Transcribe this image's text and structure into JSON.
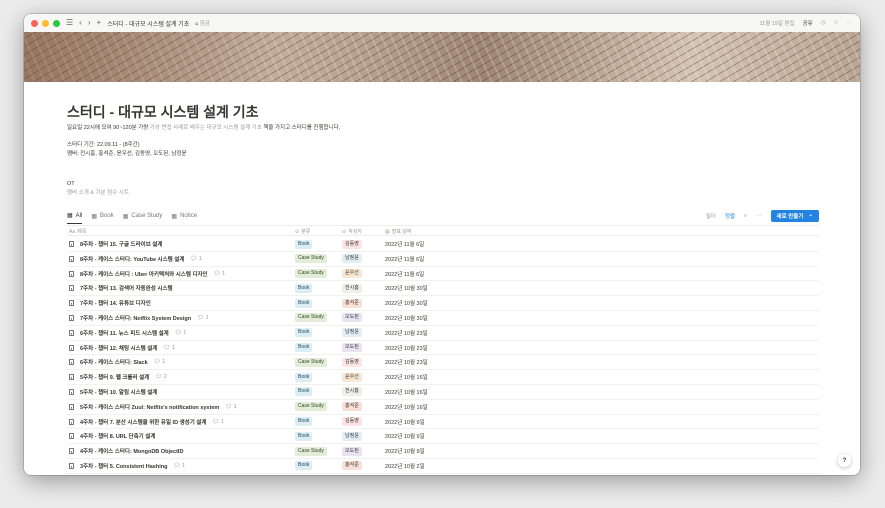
{
  "titlebar": {
    "title": "스터디 - 대규모 시스템 설계 기초",
    "lock_label": "잠금",
    "edited": "11월 19일 편집",
    "share": "공유"
  },
  "page": {
    "title": "스터디 - 대규모 시스템 설계 기초",
    "desc_main": "일요일 22시에 모여 90~120분 가량",
    "desc_muted": "가상 면접 사례로 배우는 대규모 시스템 설계 기초",
    "desc_end": "책을 가지고 스터디를 진행합니다.",
    "period": "스터디 기간: 22.09.11 - (8주간)",
    "members": "멤버: 전시흠, 홍석준, 윤우선, 김동영, 오도된, 남정윤",
    "ot": "OT",
    "ot_sub": "멤버 소개 & 기분 점수 시트"
  },
  "tabs": [
    {
      "label": "All",
      "icon": "grid-icon"
    },
    {
      "label": "Book",
      "icon": "grid-icon"
    },
    {
      "label": "Case Study",
      "icon": "grid-icon"
    },
    {
      "label": "Notice",
      "icon": "grid-icon"
    }
  ],
  "toolbar": {
    "filter": "필터",
    "sort": "정렬",
    "more": "···",
    "new_button": "새로 만들기",
    "new_chevron": "⌄"
  },
  "columns": {
    "name": "제목",
    "category": "분류",
    "author": "작성자",
    "date": "발표 날짜"
  },
  "colors": {
    "accent": "#2383e2",
    "book_tag": "#dbeef4",
    "case_tag": "#e2ecd9"
  },
  "rows": [
    {
      "name": "8주차 - 챕터 15. 구글 드라이브 설계",
      "comments": "",
      "category": "Book",
      "author": "김동영",
      "author_color": "#fbe4e4",
      "date": "2022년 11월 6일"
    },
    {
      "name": "8주차 - 케이스 스터디: YouTube 시스템 설계",
      "comments": "1",
      "category": "Case Study",
      "author": "남정윤",
      "author_color": "#e1eef5",
      "date": "2022년 11월 6일"
    },
    {
      "name": "8주차 - 케이스 스터디 : Uber 아키텍처와 시스템 디자인",
      "comments": "1",
      "category": "Case Study",
      "author": "윤우선",
      "author_color": "#f9e8d5",
      "date": "2022년 11월 6일"
    },
    {
      "name": "7주차 - 챕터 13. 검색어 자동완성 시스템",
      "comments": "",
      "category": "Book",
      "author": "전시흠",
      "author_color": "#eeeeec",
      "date": "2022년 10월 30일"
    },
    {
      "name": "7주차 - 챕터 14. 유튜브 디자인",
      "comments": "",
      "category": "Book",
      "author": "홍석준",
      "author_color": "#f9e0d6",
      "date": "2022년 10월 30일"
    },
    {
      "name": "7주차 - 케이스 스터디: Netflix System Design",
      "comments": "1",
      "category": "Case Study",
      "author": "오도된",
      "author_color": "#e8e3f3",
      "date": "2022년 10월 30일"
    },
    {
      "name": "6주차 - 챕터 11. 뉴스 피드 시스템 설계",
      "comments": "1",
      "category": "Book",
      "author": "남정윤",
      "author_color": "#e1eef5",
      "date": "2022년 10월 23일"
    },
    {
      "name": "6주차 - 챕터 12. 채팅 시스템 설계",
      "comments": "1",
      "category": "Book",
      "author": "오도된",
      "author_color": "#e8e3f3",
      "date": "2022년 10월 23일"
    },
    {
      "name": "6주차 - 케이스 스터디: Slack",
      "comments": "1",
      "category": "Case Study",
      "author": "김동영",
      "author_color": "#fbe4e4",
      "date": "2022년 10월 23일"
    },
    {
      "name": "5주차 - 챕터 9. 웹 크롤러 설계",
      "comments": "2",
      "category": "Book",
      "author": "윤우선",
      "author_color": "#f9e8d5",
      "date": "2022년 10월 16일"
    },
    {
      "name": "5주차 - 챕터 10. 알림 시스템 설계",
      "comments": "",
      "category": "Book",
      "author": "전시흠",
      "author_color": "#eeeeec",
      "date": "2022년 10월 16일"
    },
    {
      "name": "5주차 - 케이스 스터디 Zuul: Netflix's notification system",
      "comments": "1",
      "category": "Case Study",
      "author": "홍석준",
      "author_color": "#f9e0d6",
      "date": "2022년 10월 16일"
    },
    {
      "name": "4주차 - 챕터 7. 분산 시스템을 위한 유일 ID 생성기 설계",
      "comments": "1",
      "category": "Book",
      "author": "김동영",
      "author_color": "#fbe4e4",
      "date": "2022년 10월 9일"
    },
    {
      "name": "4주차 - 챕터 8. URL 단축기 설계",
      "comments": "",
      "category": "Book",
      "author": "남정윤",
      "author_color": "#e1eef5",
      "date": "2022년 10월 9일"
    },
    {
      "name": "4주차 - 케이스 스터디: MongoDB ObjectID",
      "comments": "",
      "category": "Case Study",
      "author": "오도된",
      "author_color": "#e8e3f3",
      "date": "2022년 10월 9일"
    },
    {
      "name": "3주차 - 챕터 5. Consistent Hashing",
      "comments": "1",
      "category": "Book",
      "author": "홍석준",
      "author_color": "#f9e0d6",
      "date": "2022년 10월 2일"
    }
  ],
  "help": "?"
}
